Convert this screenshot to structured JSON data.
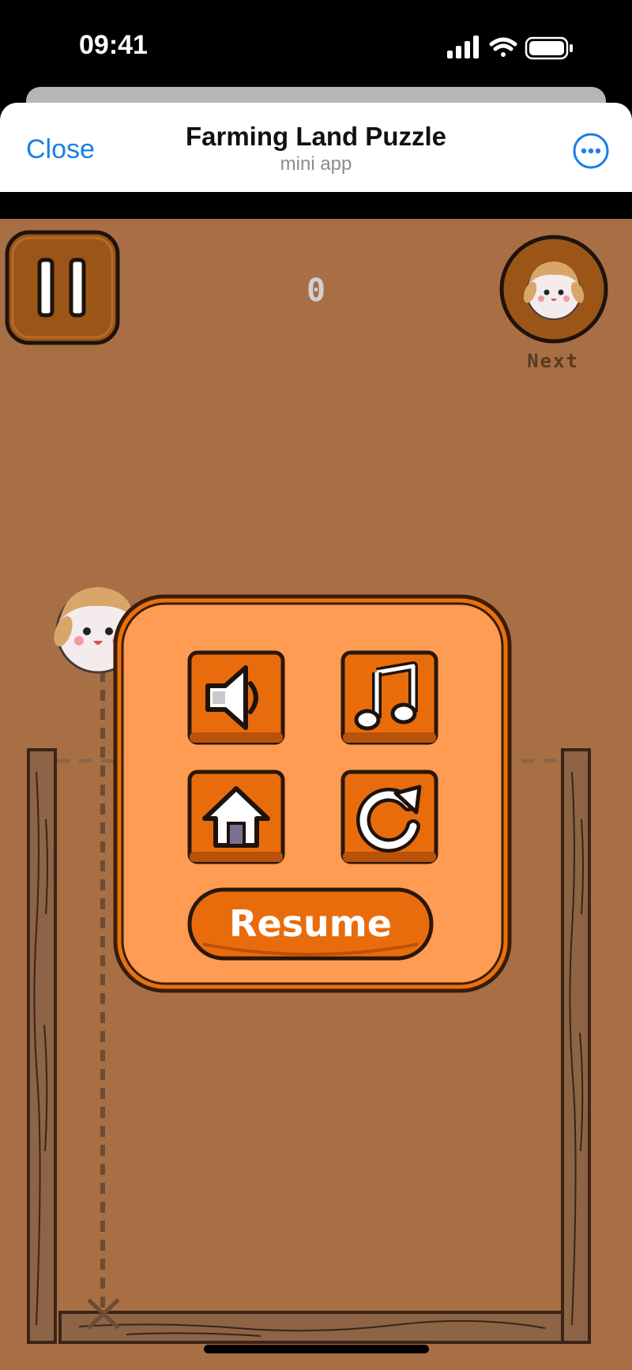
{
  "status_bar": {
    "time": "09:41"
  },
  "header": {
    "close_label": "Close",
    "title": "Farming Land Puzzle",
    "subtitle": "mini app",
    "more_icon": "more-dots-icon"
  },
  "game": {
    "score": "0",
    "next_label": "Next",
    "pause_icon": "pause-icon",
    "next_piece_icon": "puppy-icon",
    "current_piece_icon": "puppy-icon"
  },
  "pause_menu": {
    "buttons": [
      {
        "icon": "speaker-icon"
      },
      {
        "icon": "music-note-icon"
      },
      {
        "icon": "home-icon"
      },
      {
        "icon": "restart-icon"
      }
    ],
    "resume_label": "Resume"
  },
  "colors": {
    "background": "#a86f45",
    "panel": "#ff9b52",
    "button": "#e96c0c",
    "wood": "#8d6446",
    "outline": "#3b2416",
    "link": "#1a7fe6"
  }
}
